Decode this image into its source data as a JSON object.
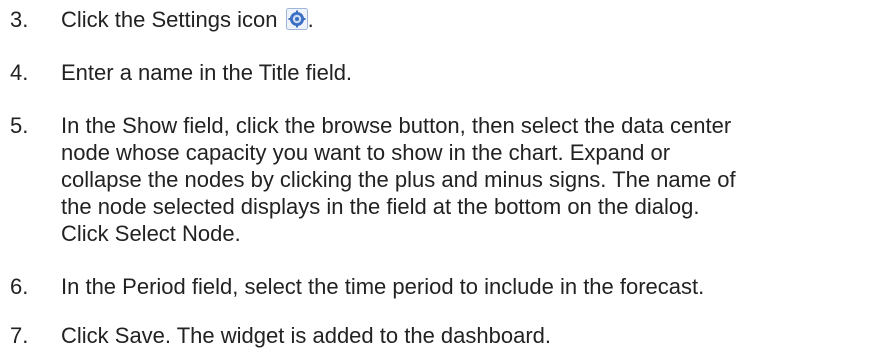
{
  "steps": [
    {
      "number": "3.",
      "before_icon": "Click the Settings icon",
      "icon": "gear-icon",
      "after_icon": "."
    },
    {
      "number": "4.",
      "text": "Enter a name in the Title field."
    },
    {
      "number": "5.",
      "lines": [
        "In the Show field, click the browse button, then select the data center",
        "node whose capacity you want to show in the chart. Expand or",
        "collapse the nodes by clicking the plus and minus signs. The name of",
        "the node selected displays in the field at the bottom on the dialog.",
        "Click Select Node."
      ]
    },
    {
      "number": "6.",
      "text": "In the Period field, select the time period to include in the forecast."
    },
    {
      "number": "7.",
      "text": "Click Save. The widget is added to the dashboard."
    }
  ],
  "colors": {
    "text": "#222222",
    "icon_blue": "#3a6fc4"
  }
}
